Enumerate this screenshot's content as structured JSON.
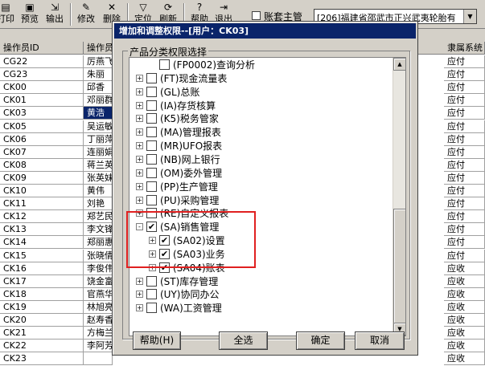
{
  "toolbar": {
    "buttons": [
      {
        "label": "打印",
        "icon": "printer-icon"
      },
      {
        "label": "预览",
        "icon": "preview-icon"
      },
      {
        "label": "输出",
        "icon": "export-icon"
      },
      {
        "label": "修改",
        "icon": "edit-icon"
      },
      {
        "label": "删除",
        "icon": "delete-icon"
      },
      {
        "label": "定位",
        "icon": "filter-icon"
      },
      {
        "label": "刷新",
        "icon": "refresh-icon"
      },
      {
        "label": "帮助",
        "icon": "help-icon"
      },
      {
        "label": "退出",
        "icon": "exit-icon"
      }
    ],
    "account_checkbox_label": "账套主管",
    "account_combo_value": "[206]福建省邵武市正兴武夷轮胎有"
  },
  "grid": {
    "columns": [
      "操作员ID",
      "操作员",
      "隶属系统"
    ],
    "rows": [
      {
        "id": "CG22",
        "name": "厉燕飞",
        "system": "应付"
      },
      {
        "id": "CG23",
        "name": "朱丽",
        "system": "应付"
      },
      {
        "id": "CK00",
        "name": "邱香",
        "system": "应付"
      },
      {
        "id": "CK01",
        "name": "邓丽群",
        "system": "应付"
      },
      {
        "id": "CK03",
        "name": "黄浩",
        "system": "应付"
      },
      {
        "id": "CK05",
        "name": "吴运敏",
        "system": "应付"
      },
      {
        "id": "CK06",
        "name": "丁丽萍",
        "system": "应付"
      },
      {
        "id": "CK07",
        "name": "连丽娟",
        "system": "应付"
      },
      {
        "id": "CK08",
        "name": "蒋兰英",
        "system": "应付"
      },
      {
        "id": "CK09",
        "name": "张英妹",
        "system": "应付"
      },
      {
        "id": "CK10",
        "name": "黄伟",
        "system": "应付"
      },
      {
        "id": "CK11",
        "name": "刘艳",
        "system": "应付"
      },
      {
        "id": "CK12",
        "name": "郑艺民",
        "system": "应付"
      },
      {
        "id": "CK13",
        "name": "李文锋",
        "system": "应付"
      },
      {
        "id": "CK14",
        "name": "郑丽惠",
        "system": "应付"
      },
      {
        "id": "CK15",
        "name": "张晓倩",
        "system": "应付"
      },
      {
        "id": "CK16",
        "name": "李俊伟",
        "system": "应收"
      },
      {
        "id": "CK17",
        "name": "饶金富",
        "system": "应收"
      },
      {
        "id": "CK18",
        "name": "官燕华",
        "system": "应收"
      },
      {
        "id": "CK19",
        "name": "林旭亮",
        "system": "应收"
      },
      {
        "id": "CK20",
        "name": "赵寿香",
        "system": "应收"
      },
      {
        "id": "CK21",
        "name": "方梅兰",
        "system": "应收"
      },
      {
        "id": "CK22",
        "name": "李阿芳",
        "system": "应收"
      },
      {
        "id": "CK23",
        "name": "",
        "system": "应收"
      }
    ]
  },
  "dialog": {
    "title": "增加和调整权限--[用户：CK03]",
    "group_label": "产品分类权限选择",
    "tree": [
      {
        "label": "(FP0002)查询分析",
        "level": 1,
        "expander": "",
        "checked": false
      },
      {
        "label": "(FT)现金流量表",
        "level": 0,
        "expander": "+",
        "checked": false
      },
      {
        "label": "(GL)总账",
        "level": 0,
        "expander": "+",
        "checked": false
      },
      {
        "label": "(IA)存货核算",
        "level": 0,
        "expander": "+",
        "checked": false
      },
      {
        "label": "(K5)税务管家",
        "level": 0,
        "expander": "+",
        "checked": false
      },
      {
        "label": "(MA)管理报表",
        "level": 0,
        "expander": "+",
        "checked": false
      },
      {
        "label": "(MR)UFO报表",
        "level": 0,
        "expander": "+",
        "checked": false
      },
      {
        "label": "(NB)网上银行",
        "level": 0,
        "expander": "+",
        "checked": false
      },
      {
        "label": "(OM)委外管理",
        "level": 0,
        "expander": "+",
        "checked": false
      },
      {
        "label": "(PP)生产管理",
        "level": 0,
        "expander": "+",
        "checked": false
      },
      {
        "label": "(PU)采购管理",
        "level": 0,
        "expander": "+",
        "checked": false
      },
      {
        "label": "(RE)自定义报表",
        "level": 0,
        "expander": "+",
        "checked": false
      },
      {
        "label": "(SA)销售管理",
        "level": 0,
        "expander": "-",
        "checked": true
      },
      {
        "label": "(SA02)设置",
        "level": 1,
        "expander": "+",
        "checked": true
      },
      {
        "label": "(SA03)业务",
        "level": 1,
        "expander": "+",
        "checked": true
      },
      {
        "label": "(SA04)账表",
        "level": 1,
        "expander": "+",
        "checked": true
      },
      {
        "label": "(ST)库存管理",
        "level": 0,
        "expander": "+",
        "checked": false
      },
      {
        "label": "(UY)协同办公",
        "level": 0,
        "expander": "+",
        "checked": false
      },
      {
        "label": "(WA)工资管理",
        "level": 0,
        "expander": "+",
        "checked": false
      }
    ],
    "buttons": {
      "help": "帮助(H)",
      "select_all": "全选",
      "ok": "确定",
      "cancel": "取消"
    },
    "checkmark": "✔"
  }
}
